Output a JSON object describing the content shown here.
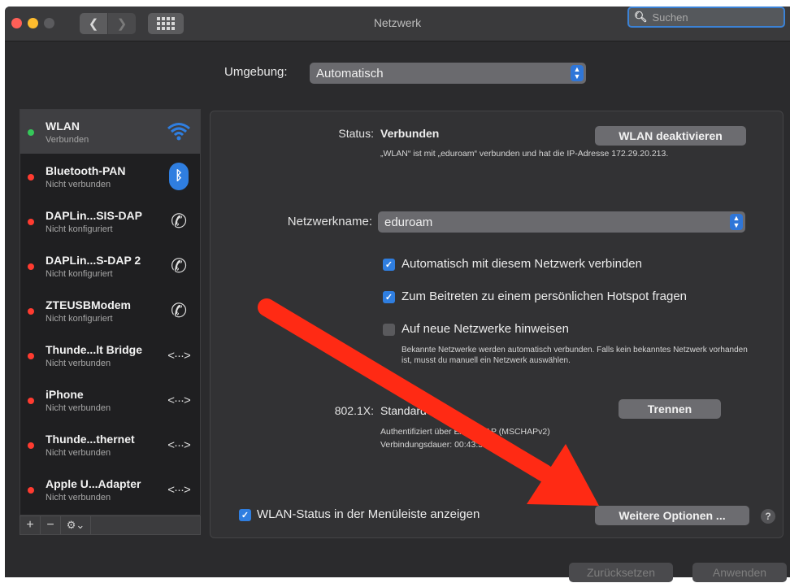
{
  "window": {
    "title": "Netzwerk"
  },
  "toolbar": {
    "back_label": "❮",
    "forward_label": "❯"
  },
  "search": {
    "placeholder": "Suchen"
  },
  "environment": {
    "label": "Umgebung:",
    "value": "Automatisch"
  },
  "sidebar": {
    "items": [
      {
        "name": "WLAN",
        "status": "Verbunden",
        "dot": "#35c759",
        "icon": "wifi-icon"
      },
      {
        "name": "Bluetooth-PAN",
        "status": "Nicht verbunden",
        "dot": "#ff3b30",
        "icon": "bluetooth-icon"
      },
      {
        "name": "DAPLin...SIS-DAP",
        "status": "Nicht konfiguriert",
        "dot": "#ff3b30",
        "icon": "phone-icon"
      },
      {
        "name": "DAPLin...S-DAP 2",
        "status": "Nicht konfiguriert",
        "dot": "#ff3b30",
        "icon": "phone-icon"
      },
      {
        "name": "ZTEUSBModem",
        "status": "Nicht konfiguriert",
        "dot": "#ff3b30",
        "icon": "phone-icon"
      },
      {
        "name": "Thunde...lt Bridge",
        "status": "Nicht verbunden",
        "dot": "#ff3b30",
        "icon": "ethernet-icon"
      },
      {
        "name": "iPhone",
        "status": "Nicht verbunden",
        "dot": "#ff3b30",
        "icon": "ethernet-icon"
      },
      {
        "name": "Thunde...thernet",
        "status": "Nicht verbunden",
        "dot": "#ff3b30",
        "icon": "ethernet-icon"
      },
      {
        "name": "Apple U...Adapter",
        "status": "Nicht verbunden",
        "dot": "#ff3b30",
        "icon": "ethernet-icon"
      }
    ],
    "footer": {
      "add": "+",
      "remove": "−",
      "gear": "⚙︎⌄"
    }
  },
  "detail": {
    "status_label": "Status:",
    "status_value": "Verbunden",
    "status_desc": "„WLAN“ ist mit „eduroam“ verbunden und hat die IP-Adresse 172.29.20.213.",
    "wlan_off_button": "WLAN deaktivieren",
    "network_name_label": "Netzwerkname:",
    "network_name_value": "eduroam",
    "checkboxes": [
      {
        "label": "Automatisch mit diesem Netzwerk verbinden",
        "checked": true
      },
      {
        "label": "Zum Beitreten zu einem persönlichen Hotspot fragen",
        "checked": true
      },
      {
        "label": "Auf neue Netzwerke hinweisen",
        "checked": false
      }
    ],
    "hint": "Bekannte Netzwerke werden automatisch verbunden. Falls kein bekanntes Netzwerk vorhanden ist, musst du manuell ein Netzwerk auswählen.",
    "dot1x_label": "802.1X:",
    "dot1x_value": "Standard",
    "dot1x_auth": "Authentifiziert über EAP-PEAP (MSCHAPv2)",
    "dot1x_duration": "Verbindungsdauer: 00:43:38",
    "disconnect_button": "Trennen",
    "menubar_checkbox": "WLAN-Status in der Menüleiste anzeigen",
    "more_options_button": "Weitere Optionen ...",
    "help": "?"
  },
  "footer": {
    "revert_button": "Zurücksetzen",
    "apply_button": "Anwenden"
  },
  "colors": {
    "accent": "#2f7ee0",
    "annotation_arrow": "#ff2a14"
  }
}
